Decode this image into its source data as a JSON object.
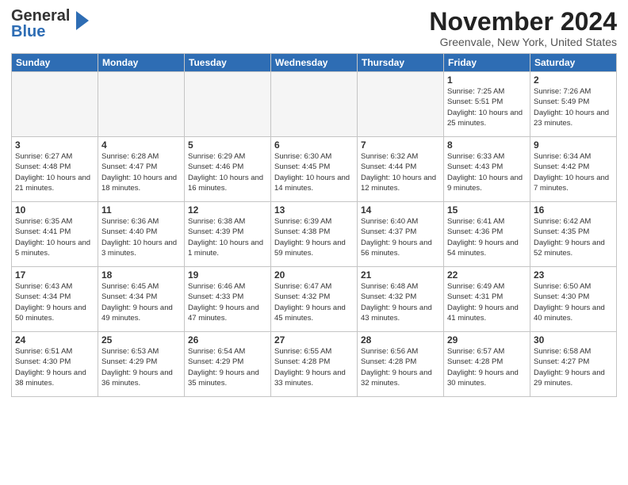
{
  "header": {
    "logo_general": "General",
    "logo_blue": "Blue",
    "title": "November 2024",
    "location": "Greenvale, New York, United States"
  },
  "weekdays": [
    "Sunday",
    "Monday",
    "Tuesday",
    "Wednesday",
    "Thursday",
    "Friday",
    "Saturday"
  ],
  "weeks": [
    [
      {
        "day": "",
        "info": ""
      },
      {
        "day": "",
        "info": ""
      },
      {
        "day": "",
        "info": ""
      },
      {
        "day": "",
        "info": ""
      },
      {
        "day": "",
        "info": ""
      },
      {
        "day": "1",
        "info": "Sunrise: 7:25 AM\nSunset: 5:51 PM\nDaylight: 10 hours and 25 minutes."
      },
      {
        "day": "2",
        "info": "Sunrise: 7:26 AM\nSunset: 5:49 PM\nDaylight: 10 hours and 23 minutes."
      }
    ],
    [
      {
        "day": "3",
        "info": "Sunrise: 6:27 AM\nSunset: 4:48 PM\nDaylight: 10 hours and 21 minutes."
      },
      {
        "day": "4",
        "info": "Sunrise: 6:28 AM\nSunset: 4:47 PM\nDaylight: 10 hours and 18 minutes."
      },
      {
        "day": "5",
        "info": "Sunrise: 6:29 AM\nSunset: 4:46 PM\nDaylight: 10 hours and 16 minutes."
      },
      {
        "day": "6",
        "info": "Sunrise: 6:30 AM\nSunset: 4:45 PM\nDaylight: 10 hours and 14 minutes."
      },
      {
        "day": "7",
        "info": "Sunrise: 6:32 AM\nSunset: 4:44 PM\nDaylight: 10 hours and 12 minutes."
      },
      {
        "day": "8",
        "info": "Sunrise: 6:33 AM\nSunset: 4:43 PM\nDaylight: 10 hours and 9 minutes."
      },
      {
        "day": "9",
        "info": "Sunrise: 6:34 AM\nSunset: 4:42 PM\nDaylight: 10 hours and 7 minutes."
      }
    ],
    [
      {
        "day": "10",
        "info": "Sunrise: 6:35 AM\nSunset: 4:41 PM\nDaylight: 10 hours and 5 minutes."
      },
      {
        "day": "11",
        "info": "Sunrise: 6:36 AM\nSunset: 4:40 PM\nDaylight: 10 hours and 3 minutes."
      },
      {
        "day": "12",
        "info": "Sunrise: 6:38 AM\nSunset: 4:39 PM\nDaylight: 10 hours and 1 minute."
      },
      {
        "day": "13",
        "info": "Sunrise: 6:39 AM\nSunset: 4:38 PM\nDaylight: 9 hours and 59 minutes."
      },
      {
        "day": "14",
        "info": "Sunrise: 6:40 AM\nSunset: 4:37 PM\nDaylight: 9 hours and 56 minutes."
      },
      {
        "day": "15",
        "info": "Sunrise: 6:41 AM\nSunset: 4:36 PM\nDaylight: 9 hours and 54 minutes."
      },
      {
        "day": "16",
        "info": "Sunrise: 6:42 AM\nSunset: 4:35 PM\nDaylight: 9 hours and 52 minutes."
      }
    ],
    [
      {
        "day": "17",
        "info": "Sunrise: 6:43 AM\nSunset: 4:34 PM\nDaylight: 9 hours and 50 minutes."
      },
      {
        "day": "18",
        "info": "Sunrise: 6:45 AM\nSunset: 4:34 PM\nDaylight: 9 hours and 49 minutes."
      },
      {
        "day": "19",
        "info": "Sunrise: 6:46 AM\nSunset: 4:33 PM\nDaylight: 9 hours and 47 minutes."
      },
      {
        "day": "20",
        "info": "Sunrise: 6:47 AM\nSunset: 4:32 PM\nDaylight: 9 hours and 45 minutes."
      },
      {
        "day": "21",
        "info": "Sunrise: 6:48 AM\nSunset: 4:32 PM\nDaylight: 9 hours and 43 minutes."
      },
      {
        "day": "22",
        "info": "Sunrise: 6:49 AM\nSunset: 4:31 PM\nDaylight: 9 hours and 41 minutes."
      },
      {
        "day": "23",
        "info": "Sunrise: 6:50 AM\nSunset: 4:30 PM\nDaylight: 9 hours and 40 minutes."
      }
    ],
    [
      {
        "day": "24",
        "info": "Sunrise: 6:51 AM\nSunset: 4:30 PM\nDaylight: 9 hours and 38 minutes."
      },
      {
        "day": "25",
        "info": "Sunrise: 6:53 AM\nSunset: 4:29 PM\nDaylight: 9 hours and 36 minutes."
      },
      {
        "day": "26",
        "info": "Sunrise: 6:54 AM\nSunset: 4:29 PM\nDaylight: 9 hours and 35 minutes."
      },
      {
        "day": "27",
        "info": "Sunrise: 6:55 AM\nSunset: 4:28 PM\nDaylight: 9 hours and 33 minutes."
      },
      {
        "day": "28",
        "info": "Sunrise: 6:56 AM\nSunset: 4:28 PM\nDaylight: 9 hours and 32 minutes."
      },
      {
        "day": "29",
        "info": "Sunrise: 6:57 AM\nSunset: 4:28 PM\nDaylight: 9 hours and 30 minutes."
      },
      {
        "day": "30",
        "info": "Sunrise: 6:58 AM\nSunset: 4:27 PM\nDaylight: 9 hours and 29 minutes."
      }
    ]
  ],
  "accent_color": "#2e6db4"
}
